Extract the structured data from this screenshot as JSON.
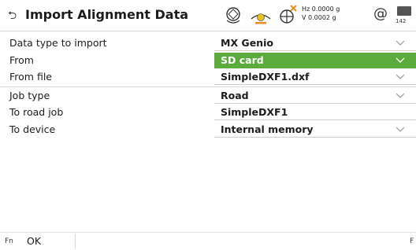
{
  "header": {
    "title": "Import Alignment Data",
    "hz_reading": "Hz 0.0000 g",
    "v_reading": "V  0.0002 g",
    "at_symbol": "@",
    "battery_label": "142"
  },
  "form": {
    "rows": [
      {
        "label": "Data type to import",
        "value": "MX Genio",
        "has_dropdown": true
      },
      {
        "label": "From",
        "value": "SD card",
        "has_dropdown": true,
        "selected": true
      },
      {
        "label": "From file",
        "value": "SimpleDXF1.dxf",
        "has_dropdown": true
      },
      {
        "label": "Job type",
        "value": "Road",
        "has_dropdown": true
      },
      {
        "label": "To road job",
        "value": "SimpleDXF1",
        "has_dropdown": false
      },
      {
        "label": "To device",
        "value": "Internal memory",
        "has_dropdown": true
      }
    ]
  },
  "footer": {
    "fn_left": "Fn",
    "ok_label": "OK",
    "fn_right": "F"
  },
  "colors": {
    "selection_green": "#5aaa3c",
    "status_orange": "#f08a1c",
    "status_yellow": "#e8c21a"
  }
}
